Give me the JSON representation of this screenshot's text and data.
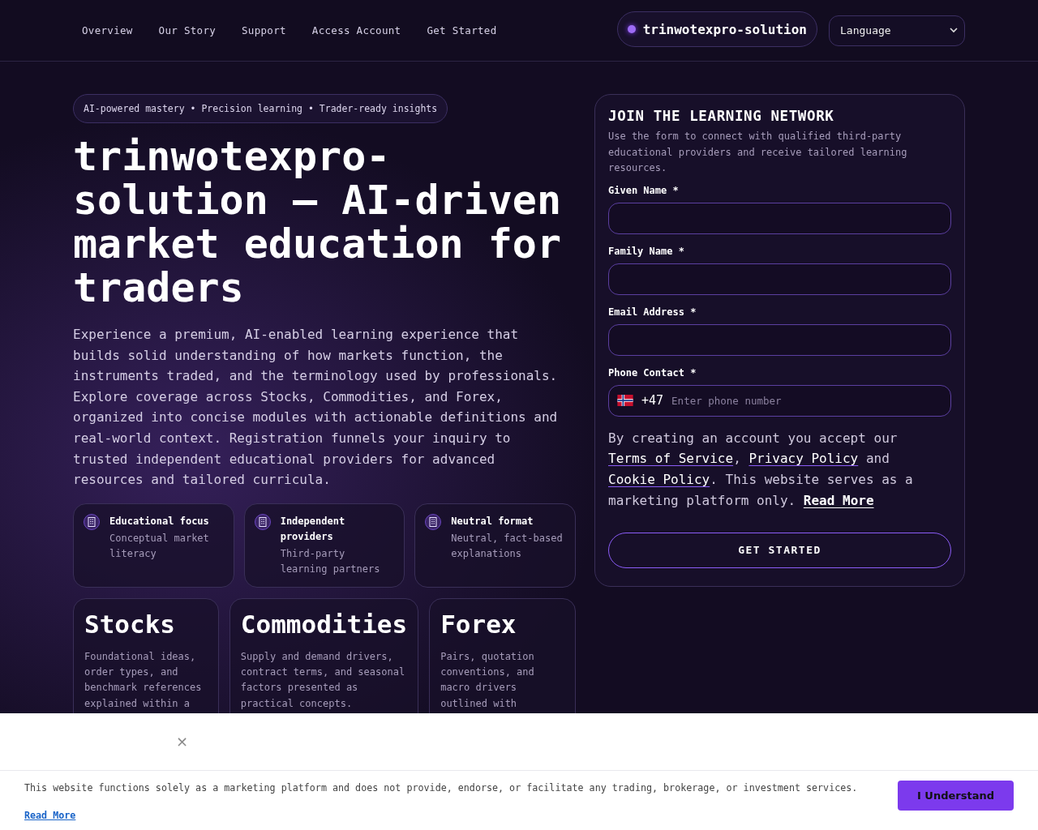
{
  "nav": {
    "links": [
      "Overview",
      "Our Story",
      "Support",
      "Access Account",
      "Get Started"
    ],
    "brand": "trinwotexpro-solution",
    "language": {
      "placeholder": "Language"
    }
  },
  "hero": {
    "badge": "AI-powered mastery • Precision learning • Trader-ready insights",
    "title": "trinwotexpro-solution — AI-driven market education for traders",
    "intro": "Experience a premium, AI-enabled learning experience that builds solid understanding of how markets function, the instruments traded, and the terminology used by professionals. Explore coverage across Stocks, Commodities, and Forex, organized into concise modules with actionable definitions and real-world context. Registration funnels your inquiry to trusted independent educational providers for advanced resources and tailored curricula.",
    "features": [
      {
        "title": "Educational focus",
        "text": "Conceptual market literacy"
      },
      {
        "title": "Independent providers",
        "text": "Third-party learning partners"
      },
      {
        "title": "Neutral format",
        "text": "Neutral, fact-based explanations"
      }
    ],
    "categories": [
      {
        "title": "Stocks",
        "text": "Foundational ideas, order types, and benchmark references explained within a"
      },
      {
        "title": "Commodities",
        "text": "Supply and demand drivers, contract terms, and seasonal factors presented as practical concepts."
      },
      {
        "title": "Forex",
        "text": "Pairs, quotation conventions, and macro drivers outlined with"
      }
    ]
  },
  "form": {
    "title": "JOIN THE LEARNING NETWORK",
    "description": "Use the form to connect with qualified third-party educational providers and receive tailored learning resources.",
    "fields": [
      {
        "label": "Given Name *",
        "kind": "text"
      },
      {
        "label": "Family Name *",
        "kind": "text"
      },
      {
        "label": "Email Address *",
        "kind": "text"
      },
      {
        "label": "Phone Contact *",
        "kind": "phone",
        "dial_code": "+47",
        "placeholder": "Enter phone number"
      }
    ],
    "consent": [
      {
        "text": "By creating an account you accept our ",
        "link": false
      },
      {
        "text": "Terms of Service",
        "link": true
      },
      {
        "text": ", ",
        "link": false
      },
      {
        "text": "Privacy Policy",
        "link": true
      },
      {
        "text": " and ",
        "link": false
      },
      {
        "text": "Cookie Policy",
        "link": true
      },
      {
        "text": ". This website serves as a marketing platform only. ",
        "link": false
      },
      {
        "text": "Read More",
        "link": true
      }
    ],
    "submit": "GET STARTED"
  },
  "cookie": {
    "close": "×",
    "text": "This website functions solely as a marketing platform and does not provide, endorse, or facilitate any trading, brokerage, or investment services.",
    "read_more": "Read More",
    "button": "I Understand"
  }
}
